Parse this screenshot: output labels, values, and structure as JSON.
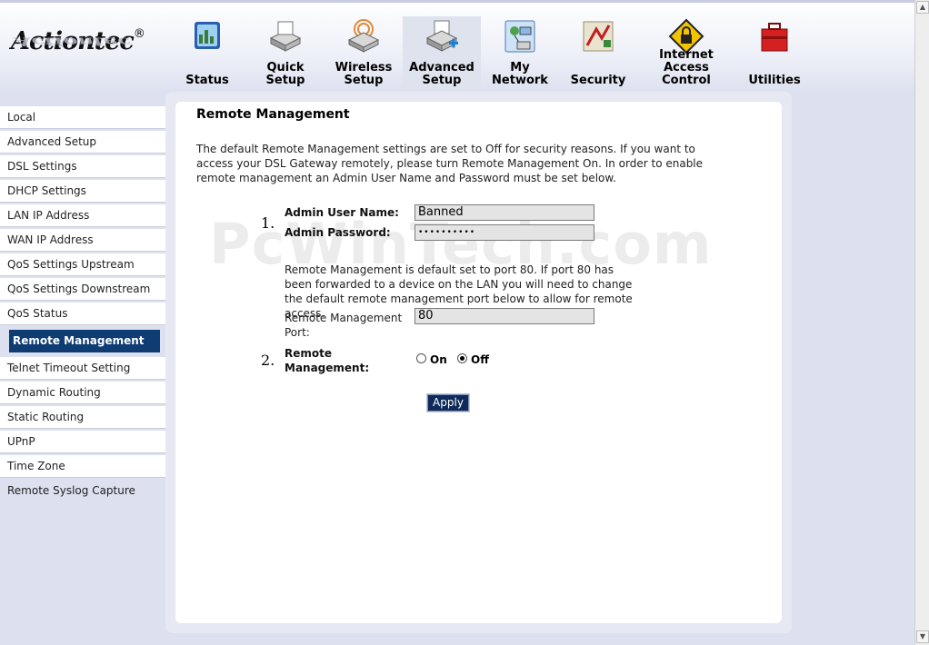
{
  "logo": {
    "text": "Actiontec",
    "reg": "®"
  },
  "nav": [
    {
      "key": "status",
      "label": "Status",
      "icon": "status-icon"
    },
    {
      "key": "quick-setup",
      "label": "Quick Setup",
      "icon": "quick-setup-icon"
    },
    {
      "key": "wireless-setup",
      "label": "Wireless Setup",
      "icon": "wireless-setup-icon"
    },
    {
      "key": "advanced-setup",
      "label": "Advanced Setup",
      "icon": "advanced-setup-icon",
      "active": true
    },
    {
      "key": "my-network",
      "label": "My Network",
      "icon": "my-network-icon"
    },
    {
      "key": "security",
      "label": "Security",
      "icon": "security-icon"
    },
    {
      "key": "internet-access-control",
      "label": "Internet Access Control",
      "icon": "lock-icon"
    },
    {
      "key": "utilities",
      "label": "Utilities",
      "icon": "toolbox-icon"
    }
  ],
  "sidebar": {
    "items": [
      "Local",
      "Advanced Setup",
      "DSL Settings",
      "DHCP Settings",
      "LAN IP Address",
      "WAN IP Address",
      "QoS Settings Upstream",
      "QoS Settings Downstream",
      "QoS Status",
      "Remote Management",
      "Telnet Timeout Setting",
      "Dynamic Routing",
      "Static Routing",
      "UPnP",
      "Time Zone",
      "Remote Syslog Capture"
    ],
    "active": "Remote Management"
  },
  "main": {
    "title": "Remote Management",
    "intro": "The default Remote Management settings are set to Off for security reasons. If you want to access your DSL Gateway remotely, please turn Remote Management On. In order to enable remote management an Admin User Name and Password must be set below.",
    "step1": "1.",
    "admin_user_label": "Admin User Name:",
    "admin_user_value": "Banned",
    "admin_password_label": "Admin Password:",
    "admin_password_value": "••••••••••",
    "port_note": "Remote Management is default set to port 80. If port 80 has been forwarded to a device on the LAN you will need to change the default remote management port below to allow for remote access.",
    "port_label": "Remote Management Port:",
    "port_value": "80",
    "step2": "2.",
    "remote_mgmt_label": "Remote Management:",
    "radio_on": "On",
    "radio_off": "Off",
    "radio_selected": "Off",
    "apply_label": "Apply"
  },
  "watermark": "PcWinTech.com",
  "colors": {
    "accent": "#0e3c73",
    "panel_bg": "#e6e8f2",
    "page_bg": "#dde1ef"
  }
}
